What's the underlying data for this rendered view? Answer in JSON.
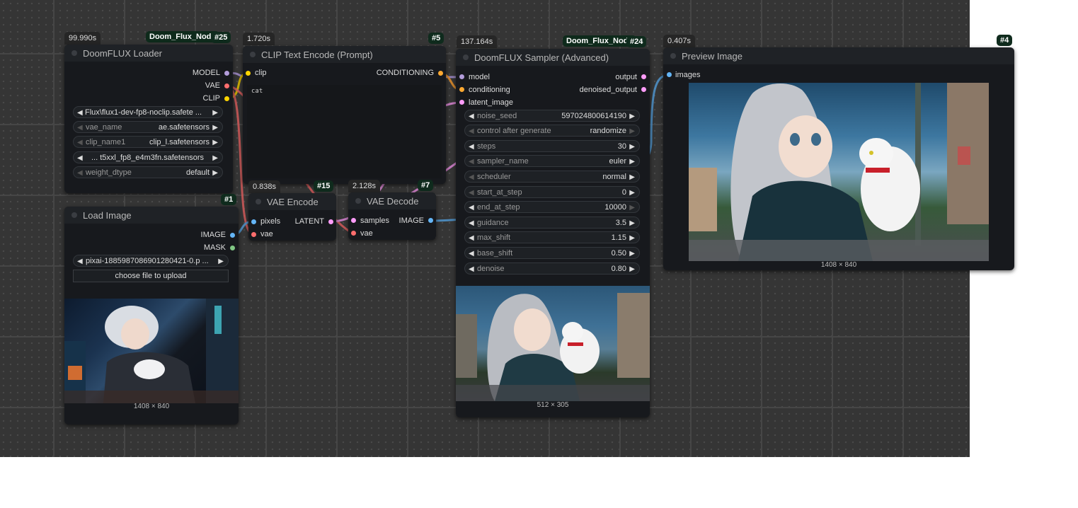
{
  "colors": {
    "model": "#b39ddb",
    "clip": "#ffd500",
    "vae": "#ff6e6e",
    "conditioning": "#ffa931",
    "latent": "#ff9cf9",
    "image": "#64b5f6",
    "mask": "#81c784"
  },
  "nodes": {
    "loader": {
      "time": "99.990s",
      "source": "Doom_Flux_Node",
      "id": "#25",
      "title": "DoomFLUX Loader",
      "outputs": [
        "MODEL",
        "VAE",
        "CLIP"
      ],
      "widgets": [
        {
          "label": "",
          "value": "Flux\\flux1-dev-fp8-noclip.safete ..."
        },
        {
          "label": "vae_name",
          "value": "ae.safetensors"
        },
        {
          "label": "clip_name1",
          "value": "clip_l.safetensors"
        },
        {
          "label": "",
          "value": "... t5xxl_fp8_e4m3fn.safetensors"
        },
        {
          "label": "weight_dtype",
          "value": "default"
        }
      ]
    },
    "clip_text": {
      "time": "1.720s",
      "id": "#5",
      "title": "CLIP Text Encode (Prompt)",
      "input": "clip",
      "output": "CONDITIONING",
      "text": "cat"
    },
    "load_image": {
      "id": "#1",
      "title": "Load Image",
      "outputs": [
        "IMAGE",
        "MASK"
      ],
      "file": "pixai-1885987086901280421-0.p ...",
      "upload_label": "choose file to upload",
      "dims": "1408 × 840"
    },
    "vae_encode": {
      "time": "0.838s",
      "id": "#15",
      "title": "VAE Encode",
      "inputs": [
        "pixels",
        "vae"
      ],
      "output": "LATENT"
    },
    "vae_decode": {
      "time": "2.128s",
      "id": "#7",
      "title": "VAE Decode",
      "inputs": [
        "samples",
        "vae"
      ],
      "output": "IMAGE"
    },
    "sampler": {
      "time": "137.164s",
      "source": "Doom_Flux_Node",
      "id": "#24",
      "title": "DoomFLUX Sampler (Advanced)",
      "inputs": [
        "model",
        "conditioning",
        "latent_image"
      ],
      "outputs": [
        "output",
        "denoised_output"
      ],
      "widgets": [
        {
          "label": "noise_seed",
          "value": "597024800614190"
        },
        {
          "label": "control after generate",
          "value": "randomize"
        },
        {
          "label": "steps",
          "value": "30"
        },
        {
          "label": "sampler_name",
          "value": "euler"
        },
        {
          "label": "scheduler",
          "value": "normal"
        },
        {
          "label": "start_at_step",
          "value": "0"
        },
        {
          "label": "end_at_step",
          "value": "10000"
        },
        {
          "label": "guidance",
          "value": "3.5"
        },
        {
          "label": "max_shift",
          "value": "1.15"
        },
        {
          "label": "base_shift",
          "value": "0.50"
        },
        {
          "label": "denoise",
          "value": "0.80"
        }
      ],
      "dims": "512 × 305"
    },
    "preview": {
      "time": "0.407s",
      "id": "#4",
      "title": "Preview Image",
      "input": "images",
      "dims": "1408 × 840"
    }
  }
}
